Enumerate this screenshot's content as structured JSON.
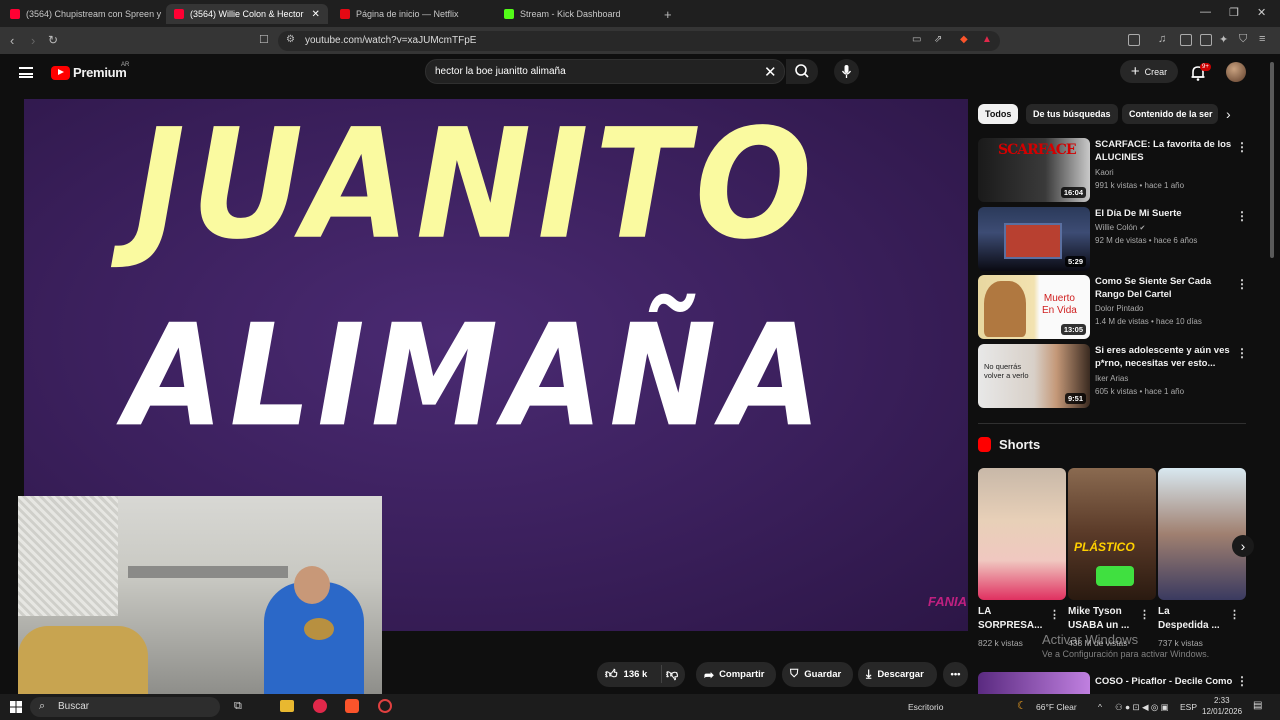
{
  "browser": {
    "tabs": [
      {
        "label": "(3564) Chupistream con Spreen y Ca",
        "active": false
      },
      {
        "label": "(3564) Willie Colon & Hector",
        "active": true
      },
      {
        "label": "Página de inicio — Netflix",
        "active": false
      },
      {
        "label": "Stream - Kick Dashboard",
        "active": false
      }
    ],
    "url": "youtube.com/watch?v=xaJUMcmTFpE"
  },
  "header": {
    "logo_text": "Premium",
    "country": "AR",
    "search_query": "hector la boe juanitto alimaña",
    "create_label": "Crear",
    "notif_count": "9+"
  },
  "video": {
    "title_line1": "JUANITO",
    "title_line2": "ALIMAÑA",
    "watermark": "FANIA"
  },
  "actions": {
    "likes": "136 k",
    "share": "Compartir",
    "save": "Guardar",
    "download": "Descargar"
  },
  "chips": [
    "Todos",
    "De tus búsquedas",
    "Contenido de la ser"
  ],
  "recommendations": [
    {
      "title": "SCARFACE: La favorita de los ALUCINES",
      "channel": "Kaori",
      "meta": "991 k vistas • hace 1 año",
      "duration": "16:04"
    },
    {
      "title": "El Día De Mi Suerte",
      "channel": "Willie Colón",
      "meta": "92 M de vistas • hace 6 años",
      "duration": "5:29"
    },
    {
      "title": "Como Se Siente Ser Cada Rango Del Cartel",
      "channel": "Dolor Pintado",
      "meta": "1.4 M de vistas • hace 10 días",
      "duration": "13:05"
    },
    {
      "title": "Si eres adolescente y aún ves p*rno, necesitas ver esto...",
      "channel": "Iker Arias",
      "meta": "605 k vistas • hace 1 año",
      "duration": "9:51"
    },
    {
      "title": "COSO - Picaflor - Decile Como",
      "channel": "",
      "meta": "",
      "duration": ""
    }
  ],
  "thumb_text": {
    "r0": "SCARFACE",
    "r2": [
      "Muerto",
      "En Vida"
    ],
    "r3": [
      "No querrás",
      "volver a verlo"
    ]
  },
  "shorts": {
    "heading": "Shorts",
    "items": [
      {
        "title": [
          "LA",
          "SORPRESA..."
        ],
        "views": "822 k vistas",
        "overlay": ""
      },
      {
        "title": [
          "Mike Tyson",
          "USABA un ..."
        ],
        "views": "438 M de vistas",
        "overlay": "PLÁSTICO"
      },
      {
        "title": [
          "La",
          "Despedida ..."
        ],
        "views": "737 k vistas",
        "overlay": ""
      }
    ]
  },
  "windows_watermark": {
    "line1": "Activar Windows",
    "line2": "Ve a Configuración para activar Windows."
  },
  "taskbar": {
    "search": "Buscar",
    "desktop": "Escritorio",
    "weather": "66°F  Clear",
    "lang": "ESP",
    "time": "2:33",
    "date": "12/01/2026"
  }
}
